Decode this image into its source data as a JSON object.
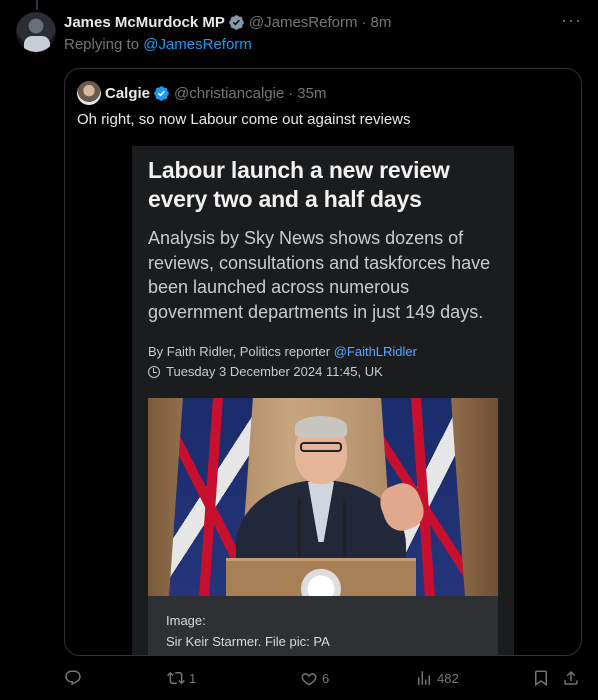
{
  "tweet": {
    "author_name": "James McMurdock MP",
    "handle": "@JamesReform",
    "separator": "·",
    "time": "8m",
    "more_label": "···",
    "replying_prefix": "Replying to",
    "replying_to": "@JamesReform"
  },
  "quoted": {
    "author_name": "Calgie",
    "handle": "@christiancalgie",
    "separator": "·",
    "time": "35m",
    "text": "Oh right, so now Labour come out against reviews",
    "article": {
      "headline": "Labour launch a new review every two and a half days",
      "subheading": "Analysis by Sky News shows dozens of reviews, consultations and taskforces have been launched across numerous government departments in just 149 days.",
      "byline_prefix": "By Faith Ridler, Politics reporter",
      "byline_handle": "@FaithLRidler",
      "date": "Tuesday 3 December 2024 11:45, UK",
      "caption_label": "Image:",
      "caption_text": "Sir Keir Starmer. File pic: PA"
    }
  },
  "actions": {
    "reply_count": "",
    "retweet_count": "1",
    "like_count": "6",
    "views_count": "482"
  },
  "icons": {
    "verified": "verified-badge-icon",
    "more": "more-icon",
    "reply": "reply-icon",
    "retweet": "retweet-icon",
    "like": "heart-icon",
    "views": "views-icon",
    "bookmark": "bookmark-icon",
    "share": "share-icon",
    "clock": "clock-icon"
  },
  "colors": {
    "background": "#000000",
    "text_primary": "#e7e9ea",
    "text_secondary": "#71767b",
    "link": "#1d9bf0",
    "border": "#2f3336",
    "verified_blue": "#1d9bf0",
    "verified_gray": "#829aab"
  }
}
